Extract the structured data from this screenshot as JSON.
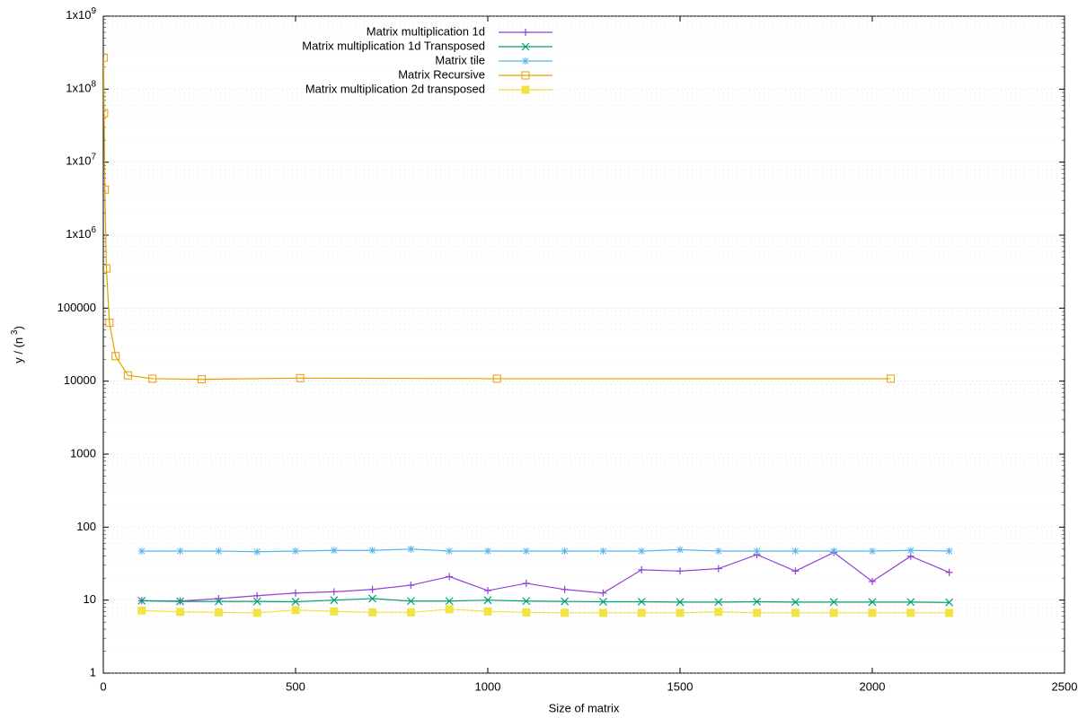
{
  "chart_data": {
    "type": "line",
    "xlabel": "Size of matrix",
    "ylabel": "y / (n^3)",
    "ylabel_html": "y / (n³)",
    "xlim": [
      0,
      2500
    ],
    "ylim": [
      1,
      1000000000.0
    ],
    "yscale": "log",
    "xticks": [
      0,
      500,
      1000,
      1500,
      2000,
      2500
    ],
    "yticks": [
      1,
      10,
      100,
      1000,
      10000,
      100000,
      1000000.0,
      10000000.0,
      100000000.0,
      1000000000.0
    ],
    "ytick_labels": [
      "1",
      "10",
      "100",
      "1000",
      "10000",
      "100000",
      "1x10^6",
      "1x10^7",
      "1x10^8",
      "1x10^9"
    ],
    "grid": true,
    "legend_position": "top-center",
    "series": [
      {
        "name": "Matrix multiplication 1d",
        "color": "#9440d5",
        "marker": "plus",
        "x": [
          100,
          200,
          300,
          400,
          500,
          600,
          700,
          800,
          900,
          1000,
          1100,
          1200,
          1300,
          1400,
          1500,
          1600,
          1700,
          1800,
          1900,
          2000,
          2100,
          2200
        ],
        "y": [
          9.8,
          9.7,
          10.5,
          11.5,
          12.5,
          13,
          14,
          16,
          21,
          13.5,
          17,
          14,
          12.5,
          26,
          25,
          27,
          42,
          25,
          45,
          18,
          40,
          24
        ]
      },
      {
        "name": "Matrix multiplication 1d Transposed",
        "color": "#009e73",
        "marker": "x",
        "x": [
          100,
          200,
          300,
          400,
          500,
          600,
          700,
          800,
          900,
          1000,
          1100,
          1200,
          1300,
          1400,
          1500,
          1600,
          1700,
          1800,
          1900,
          2000,
          2100,
          2200
        ],
        "y": [
          9.8,
          9.6,
          9.6,
          9.6,
          9.5,
          10,
          10.5,
          9.7,
          9.7,
          10,
          9.7,
          9.6,
          9.5,
          9.5,
          9.4,
          9.4,
          9.5,
          9.4,
          9.4,
          9.4,
          9.4,
          9.3
        ]
      },
      {
        "name": "Matrix tile",
        "color": "#56b4e9",
        "marker": "star",
        "x": [
          100,
          200,
          300,
          400,
          500,
          600,
          700,
          800,
          900,
          1000,
          1100,
          1200,
          1300,
          1400,
          1500,
          1600,
          1700,
          1800,
          1900,
          2000,
          2100,
          2200
        ],
        "y": [
          47,
          47,
          47,
          46,
          47,
          48,
          48,
          50,
          47,
          47,
          47,
          47,
          47,
          47,
          49,
          47,
          47,
          47,
          47,
          47,
          48,
          47
        ]
      },
      {
        "name": "Matrix Recursive",
        "color": "#e69f00",
        "marker": "square",
        "x": [
          1,
          2,
          4,
          8,
          16,
          32,
          64,
          128,
          256,
          512,
          1024,
          2048
        ],
        "y": [
          270000000.0,
          47000000.0,
          4200000.0,
          350000.0,
          63000.0,
          22000.0,
          12000.0,
          10800.0,
          10600.0,
          11000.0,
          10800.0,
          10800.0
        ]
      },
      {
        "name": "Matrix multiplication 2d transposed",
        "color": "#f0e442",
        "marker": "square-filled",
        "x": [
          100,
          200,
          300,
          400,
          500,
          600,
          700,
          800,
          900,
          1000,
          1100,
          1200,
          1300,
          1400,
          1500,
          1600,
          1700,
          1800,
          1900,
          2000,
          2100,
          2200
        ],
        "y": [
          7.2,
          6.9,
          6.8,
          6.7,
          7.3,
          7.0,
          6.8,
          6.8,
          7.5,
          7.0,
          6.8,
          6.7,
          6.7,
          6.7,
          6.7,
          6.9,
          6.7,
          6.7,
          6.7,
          6.7,
          6.7,
          6.7
        ]
      }
    ]
  },
  "legend_labels": {
    "s0": "Matrix multiplication 1d",
    "s1": "Matrix multiplication 1d Transposed",
    "s2": "Matrix tile",
    "s3": "Matrix Recursive",
    "s4": "Matrix multiplication 2d transposed"
  },
  "axis": {
    "x": "Size of matrix",
    "y": "y / (n ³)"
  }
}
